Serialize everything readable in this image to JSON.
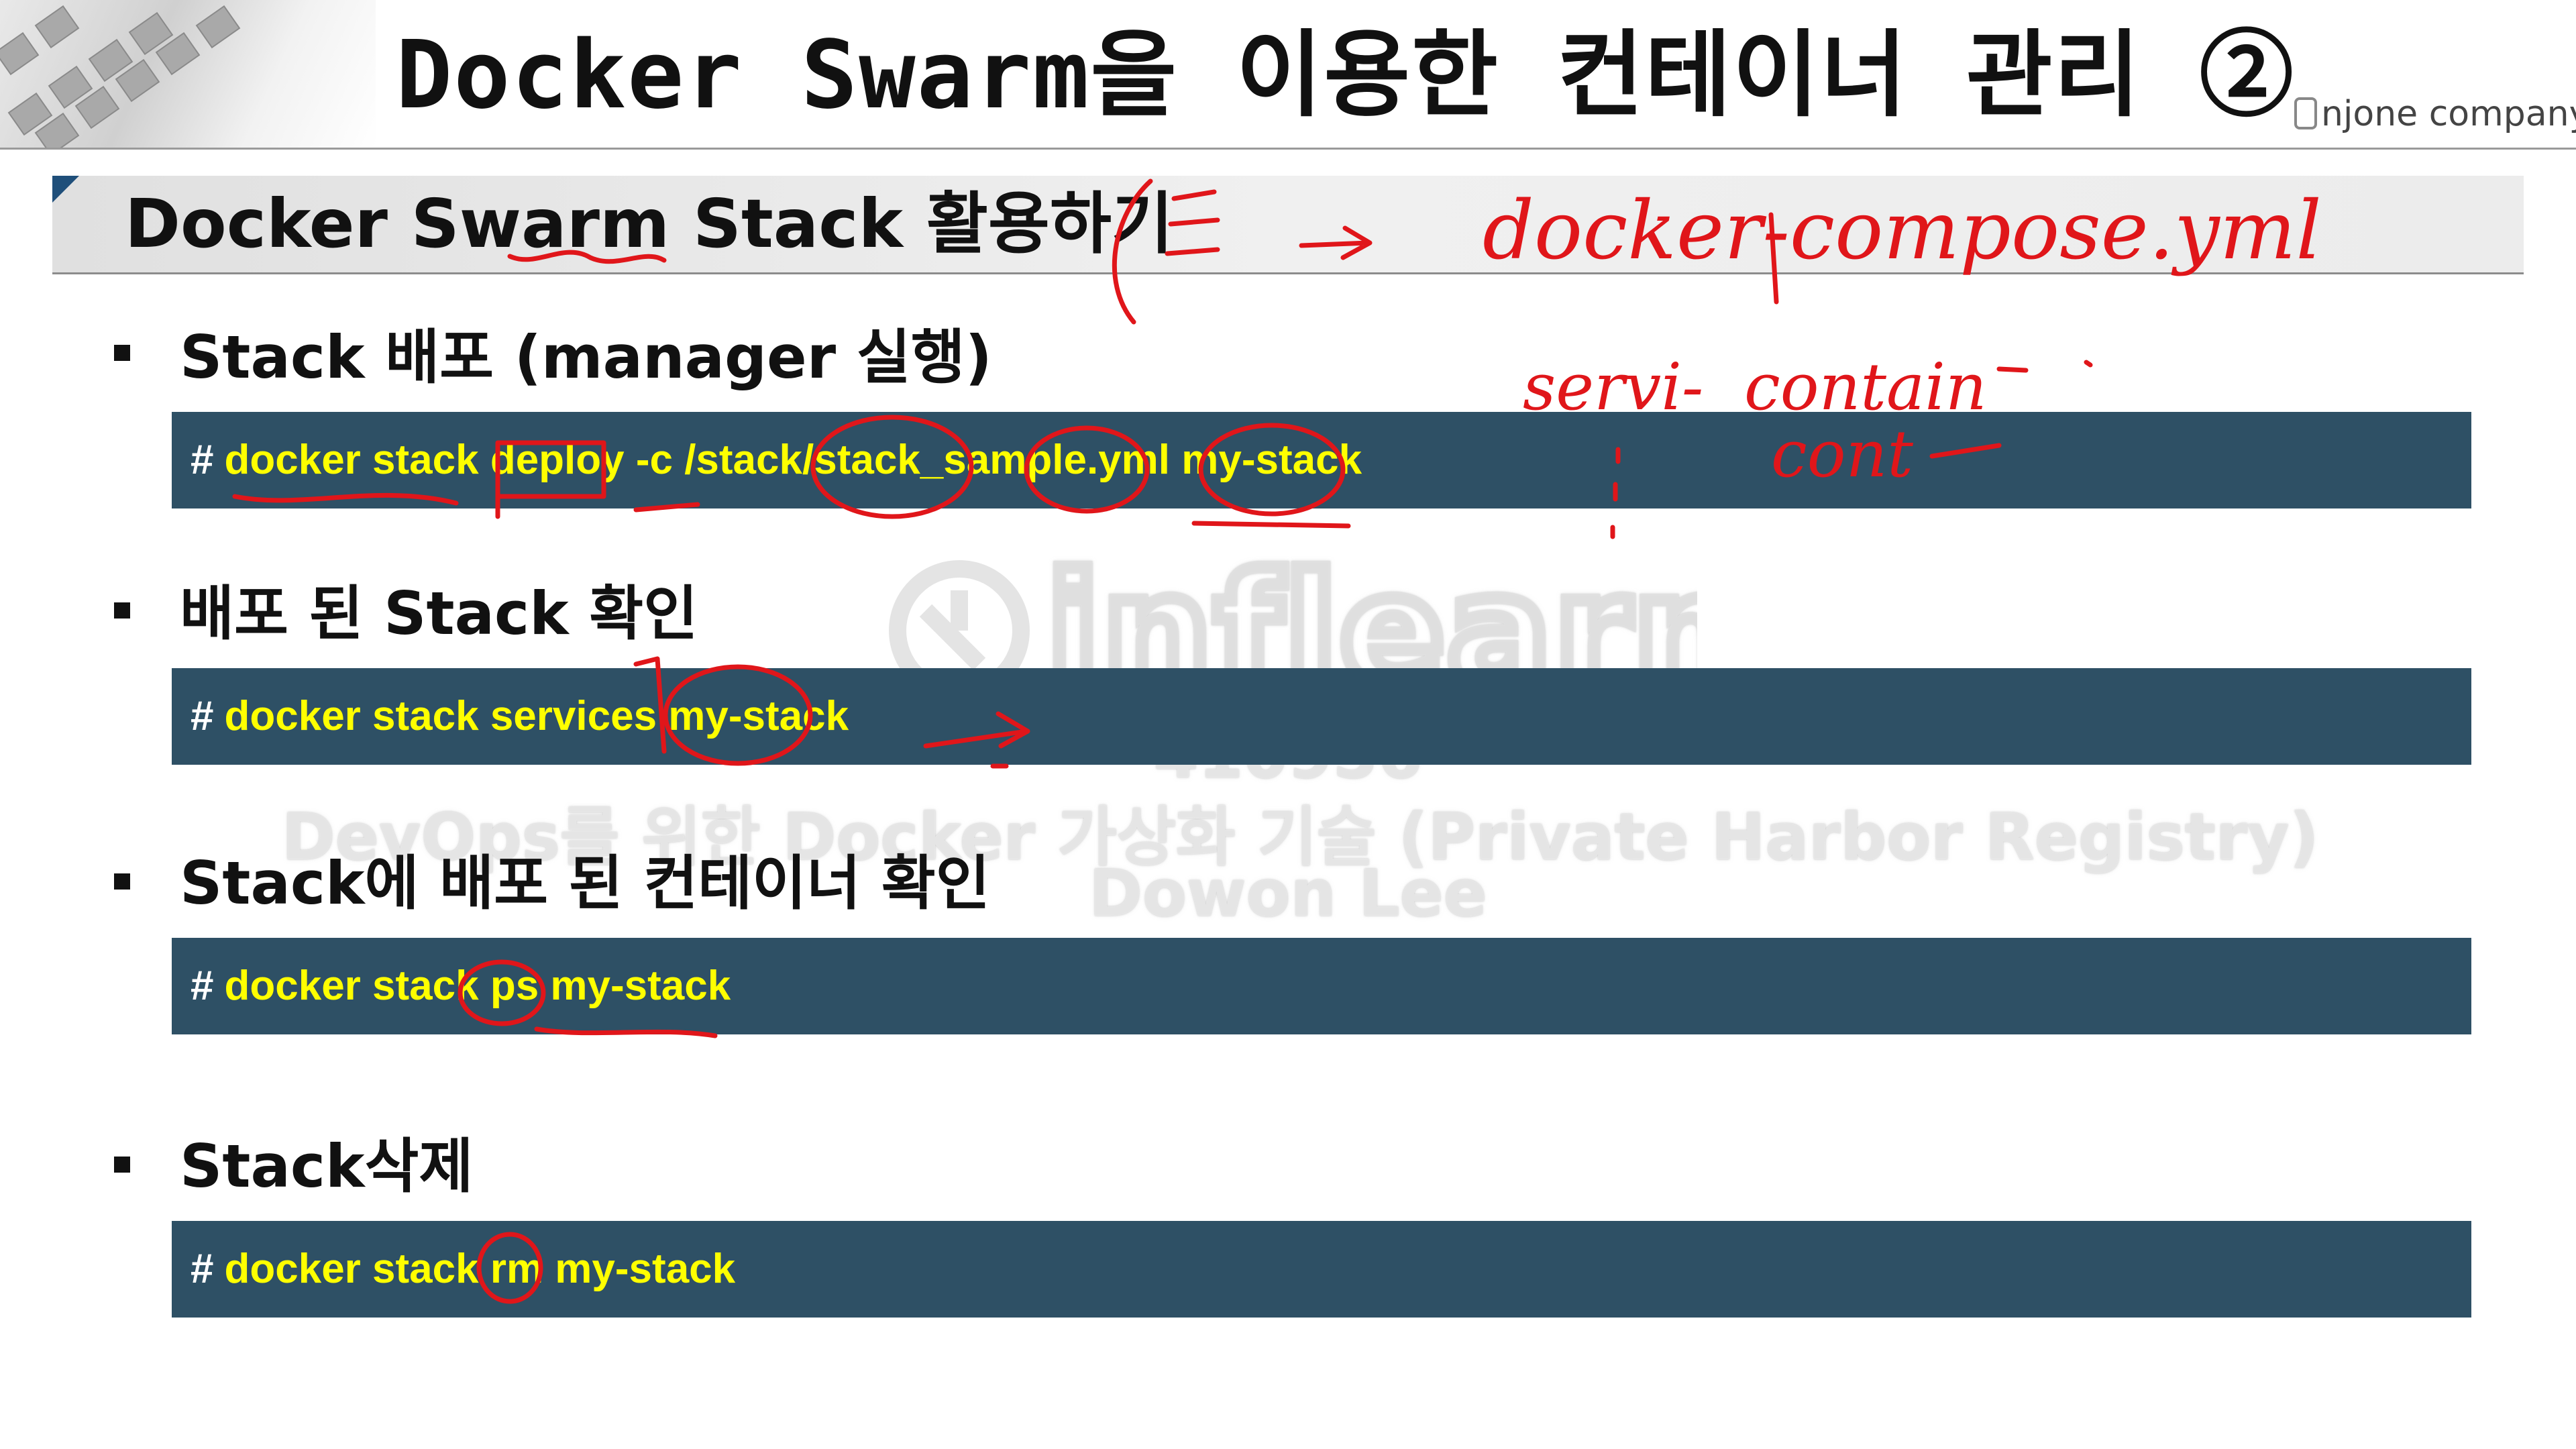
{
  "header": {
    "title": "Docker Swarm을 이용한 컨테이너 관리 ②",
    "brand": "njone company"
  },
  "section": {
    "title": "Docker Swarm Stack 활용하기"
  },
  "bullets": [
    {
      "label": "Stack 배포 (manager 실행)",
      "prompt": "#",
      "command": "docker stack deploy -c /stack/stack_sample.yml my-stack"
    },
    {
      "label": "배포 된 Stack 확인",
      "prompt": "#",
      "command": "docker stack services my-stack"
    },
    {
      "label": "Stack에 배포 된 컨테이너 확인",
      "prompt": "#",
      "command": "docker stack ps my-stack"
    },
    {
      "label": "Stack삭제",
      "prompt": "#",
      "command": "docker stack rm my-stack"
    }
  ],
  "watermark": {
    "logo": "inflearn",
    "id": "410956",
    "course": "DevOps를 위한 Docker 가상화 기술 (Private Harbor Registry)",
    "author": "Dowon Lee"
  },
  "annotations": {
    "compose_note": "docker-compose.yml",
    "service_note": "servi-",
    "container_note": "contain",
    "container_note2": "cont",
    "color": "#e0161a"
  },
  "colors": {
    "code_bg": "#2e5065",
    "code_text": "#ffff00"
  }
}
